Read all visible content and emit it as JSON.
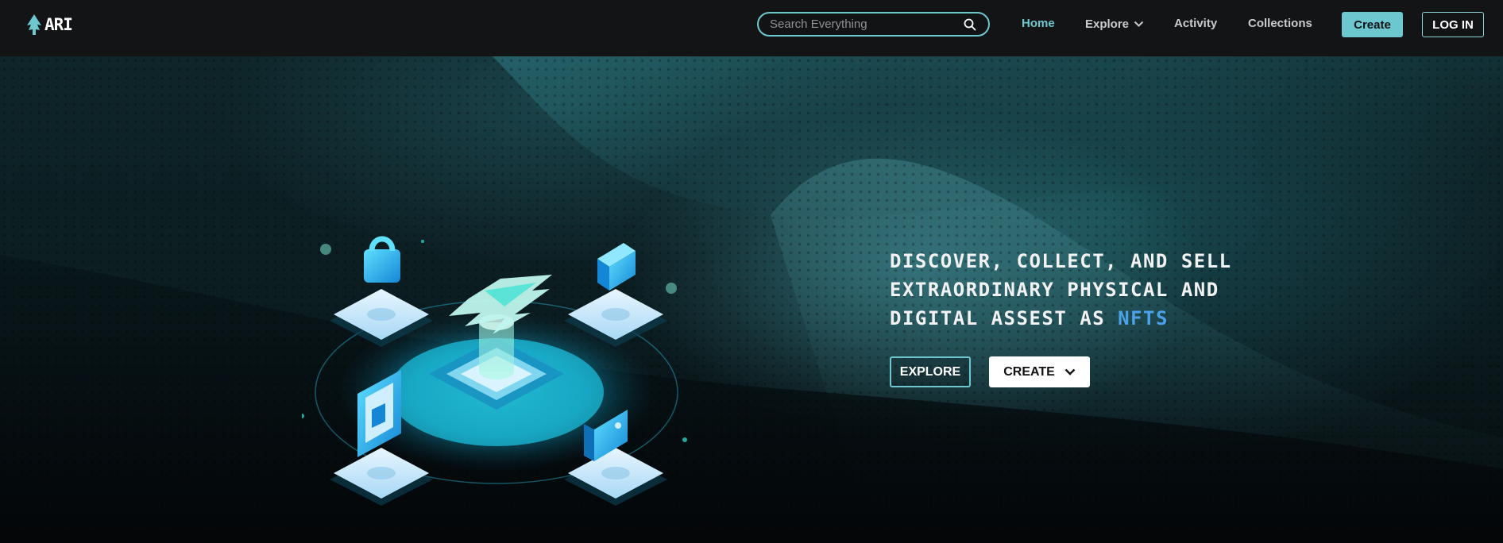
{
  "brand": {
    "logo_text": "ARI"
  },
  "search": {
    "placeholder": "Search Everything",
    "value": ""
  },
  "nav": {
    "home": "Home",
    "explore": "Explore",
    "activity": "Activity",
    "collections": "Collections",
    "create": "Create",
    "login": "LOG IN"
  },
  "hero": {
    "line1": "DISCOVER, COLLECT, AND SELL",
    "line2": "EXTRAORDINARY PHYSICAL AND",
    "line3_prefix": "DIGITAL ASSEST AS ",
    "line3_accent": "NFTS",
    "explore_button": "EXPLORE",
    "create_button": "CREATE"
  },
  "colors": {
    "accent": "#6cc7cf",
    "nft_accent": "#4aa3e8",
    "nav_bg": "#131416"
  },
  "icons": [
    "logo-tree-icon",
    "search-icon",
    "chevron-down-icon",
    "isometric-nft-platform-illustration"
  ]
}
